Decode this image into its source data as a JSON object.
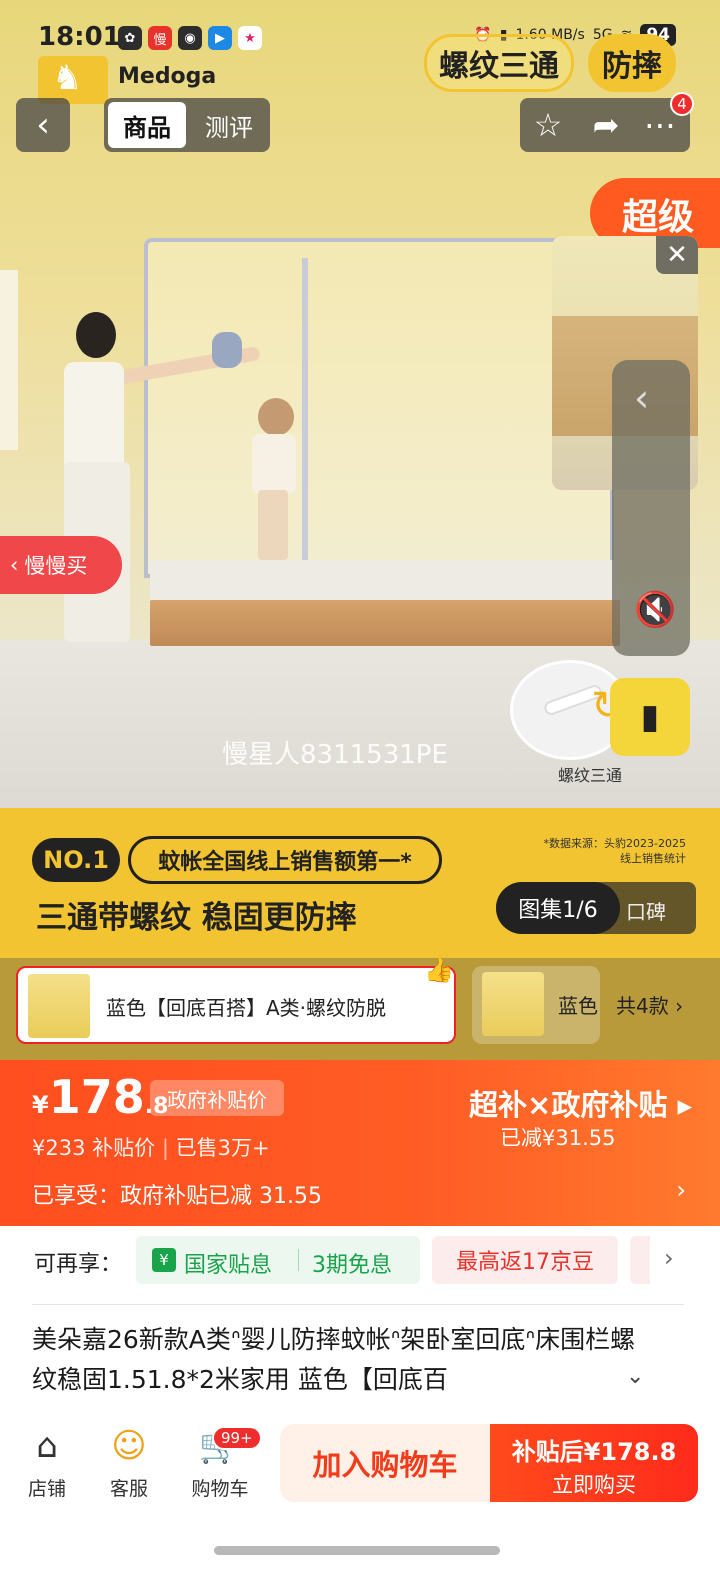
{
  "status_bar": {
    "time": "18:01",
    "network_speed": "1.60 MB/s",
    "network_type": "5G",
    "battery": "94",
    "app_icons": [
      "wechat-icon",
      "maoman-app-icon",
      "weibo-icon",
      "arrow-app-icon",
      "star-app-icon"
    ]
  },
  "brand": {
    "name": "Medoga"
  },
  "hero": {
    "tags": [
      "螺纹三通",
      "防摔"
    ],
    "promo_corner": "超级",
    "slow_buy_label": "慢慢买",
    "watermark": "慢星人8311531PE",
    "detail_label": "螺纹三通",
    "claim_badge": "NO.1",
    "claim_text": "蚊帐全国线上销售额第一*",
    "claim_source": "*数据来源：头豹2023-2025 线上销售统计",
    "claim_main": "三通带螺纹 稳固更防摔",
    "gallery_counter": "图集1/6",
    "gallery_extra": "口碑"
  },
  "nav": {
    "tabs": [
      "商品",
      "测评"
    ],
    "share_badge": "4"
  },
  "variants": {
    "selected_label": "蓝色【回底百搭】A类·螺纹防脱",
    "second_label": "蓝色",
    "count_label": "共4款"
  },
  "price": {
    "currency": "¥",
    "integer": "178",
    "decimal": ".8",
    "gov_tag": "政府补贴价",
    "original": "¥233",
    "original_label": "补贴价",
    "sold": "已售3万+",
    "subsidy_title": "超补×政府补贴",
    "reduced": "已减¥31.55",
    "enjoy_text": "已享受：政府补贴已减 31.55"
  },
  "benefits": {
    "label": "可再享：",
    "national_subsidy": "国家贴息",
    "installment": "3期免息",
    "jd_beans": "最高返17京豆"
  },
  "title": {
    "text": "美朵嘉26新款A类ᐢ婴儿防摔蚊帐ᐢ架卧室回底ᐢ床围栏螺纹稳固1.51.8*2米家用 蓝色【回底百"
  },
  "bottom_bar": {
    "store": "店铺",
    "service": "客服",
    "cart": "购物车",
    "cart_badge": "99+",
    "add_to_cart": "加入购物车",
    "buy_price": "补贴后¥178.8",
    "buy_now": "立即购买"
  },
  "colors": {
    "accent_orange": "#ff4e1f",
    "brand_yellow": "#f3c431",
    "subsidy_green": "#19a34a",
    "badge_red": "#f02d2d"
  }
}
